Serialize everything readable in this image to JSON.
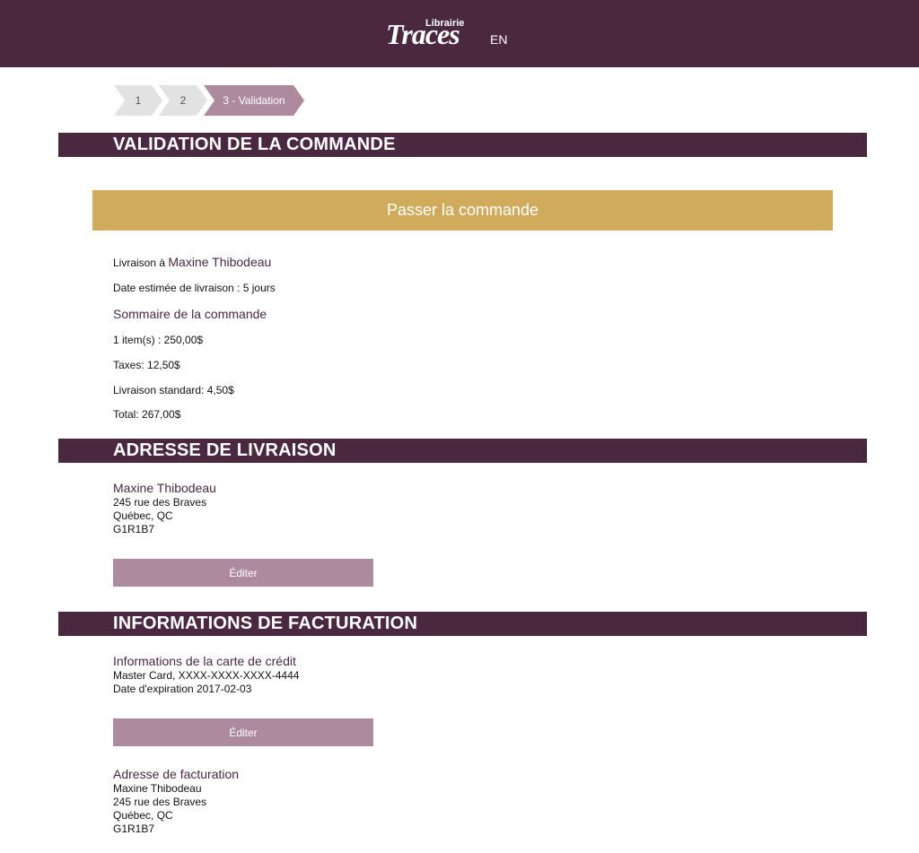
{
  "header": {
    "logo_small": "Librairie",
    "logo_big": "Traces",
    "language_link": "EN"
  },
  "steps": [
    {
      "label": "1",
      "active": false
    },
    {
      "label": "2",
      "active": false
    },
    {
      "label": "3 - Validation",
      "active": true
    }
  ],
  "sections": {
    "validation_title": "VALIDATION DE LA COMMANDE",
    "shipping_title": "ADRESSE DE LIVRAISON",
    "billing_title": "INFORMATIONS DE FACTURATION"
  },
  "order": {
    "place_order_label": "Passer la commande",
    "delivery_prefix": "Livraison à",
    "delivery_name": "Maxine Thibodeau",
    "estimated_delivery": "Date estimée de livraison : 5 jours",
    "summary_title": "Sommaire de la commande",
    "items_line": "1 item(s) : 250,00$",
    "taxes_line": "Taxes: 12,50$",
    "shipping_line": "Livraison standard: 4,50$",
    "total_line": "Total: 267,00$"
  },
  "shipping_address": {
    "name": "Maxine Thibodeau",
    "street": "245 rue des Braves",
    "city": "Québec, QC",
    "postal": "G1R1B7",
    "edit_label": "Éditer"
  },
  "billing": {
    "card_title": "Informations de la carte de crédit",
    "card_number": "Master Card, XXXX-XXXX-XXXX-4444",
    "card_expiry": "Date d'expiration 2017-02-03",
    "edit_label": "Éditer",
    "address_title": "Adresse de facturation",
    "address_name": "Maxine Thibodeau",
    "address_street": "245 rue des Braves",
    "address_city": "Québec, QC",
    "address_postal": "G1R1B7"
  },
  "colors": {
    "header": "#4a2840",
    "accent": "#4a2840",
    "order_button": "#d0ab5c",
    "edit_button": "#ad8a9e",
    "step_inactive": "#e2e2e2",
    "step_active": "#ad8a9e"
  }
}
